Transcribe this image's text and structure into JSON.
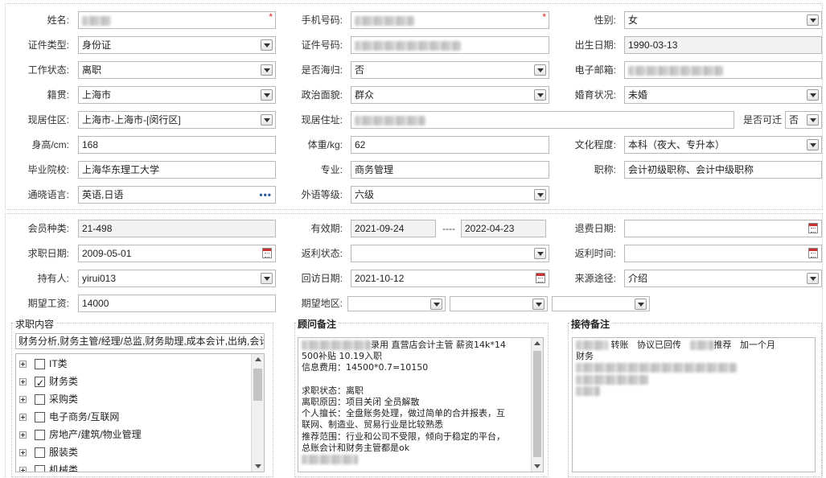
{
  "basic": {
    "name": {
      "label": "姓名:"
    },
    "phone": {
      "label": "手机号码:"
    },
    "gender": {
      "label": "性别:",
      "value": "女"
    },
    "id_type": {
      "label": "证件类型:",
      "value": "身份证"
    },
    "id_number": {
      "label": "证件号码:"
    },
    "birth_date": {
      "label": "出生日期:",
      "value": "1990-03-13"
    },
    "work_status": {
      "label": "工作状态:",
      "value": "离职"
    },
    "returnee": {
      "label": "是否海归:",
      "value": "否"
    },
    "email": {
      "label": "电子邮箱:"
    },
    "hometown": {
      "label": "籍贯:",
      "value": "上海市"
    },
    "political": {
      "label": "政治面貌:",
      "value": "群众"
    },
    "marital": {
      "label": "婚育状况:",
      "value": "未婚"
    },
    "residence_area": {
      "label": "现居住区:",
      "value": "上海市-上海市-[闵行区]"
    },
    "address": {
      "label": "现居住址:"
    },
    "relocatable": {
      "label": "是否可迁",
      "value": "否"
    },
    "height": {
      "label": "身高/cm:",
      "value": "168"
    },
    "weight": {
      "label": "体重/kg:",
      "value": "62"
    },
    "education": {
      "label": "文化程度:",
      "value": "本科（夜大、专升本）"
    },
    "school": {
      "label": "毕业院校:",
      "value": "上海华东理工大学"
    },
    "major": {
      "label": "专业:",
      "value": "商务管理"
    },
    "title": {
      "label": "职称:",
      "value": "会计初级职称、会计中级职称"
    },
    "languages": {
      "label": "通晓语言:",
      "value": "英语,日语"
    },
    "lang_level": {
      "label": "外语等级:",
      "value": "六级"
    }
  },
  "membership": {
    "member_type": {
      "label": "会员种类:",
      "value": "21-498"
    },
    "valid_period": {
      "label": "有效期:",
      "from": "2021-09-24",
      "sep": "----",
      "to": "2022-04-23"
    },
    "refund_date": {
      "label": "退费日期:",
      "value": ""
    },
    "job_date": {
      "label": "求职日期:",
      "value": "2009-05-01"
    },
    "rebate_status": {
      "label": "返利状态:",
      "value": ""
    },
    "rebate_time": {
      "label": "返利时间:",
      "value": ""
    },
    "holder": {
      "label": "持有人:",
      "value": "yirui013"
    },
    "revisit_date": {
      "label": "回访日期:",
      "value": "2021-10-12"
    },
    "source": {
      "label": "来源途径:",
      "value": "介绍"
    },
    "expected_salary": {
      "label": "期望工资:",
      "value": "14000"
    },
    "expected_area": {
      "label": "期望地区:"
    }
  },
  "job_content": {
    "title": "求职内容",
    "selected_text": "财务分析,财务主管/经理/总监,财务助理,成本会计,出纳,会计",
    "tree": [
      {
        "label": "IT类",
        "checked": false
      },
      {
        "label": "财务类",
        "checked": true
      },
      {
        "label": "采购类",
        "checked": false
      },
      {
        "label": "电子商务/互联网",
        "checked": false
      },
      {
        "label": "房地产/建筑/物业管理",
        "checked": false
      },
      {
        "label": "服装类",
        "checked": false
      },
      {
        "label": "机械类",
        "checked": false
      }
    ]
  },
  "advisor_notes": {
    "title": "顾问备注",
    "lines": [
      "录用 直营店会计主管 薪资14k*14",
      "500补贴   10.19入职",
      "信息费用：14500*0.7=10150",
      "",
      "求职状态：离职",
      "离职原因：项目关闭 全员解散",
      "个人擅长：全盘账务处理，做过简单的合并报表，互",
      "联网、制造业、贸易行业是比较熟悉",
      "推荐范围：行业和公司不受限，倾向于稳定的平台，",
      "总账会计和财务主管都是ok"
    ]
  },
  "reception_notes": {
    "title": "接待备注",
    "line1_a": "转账",
    "line1_b": "协议已回传",
    "line1_c": "推荐",
    "line1_d": "加一个月",
    "line2": "财务"
  },
  "colors": {
    "required": "#e02020",
    "field_border": "#b9b9b9",
    "readonly_bg": "#f3f3f3",
    "link_blue": "#2a5d9f"
  }
}
